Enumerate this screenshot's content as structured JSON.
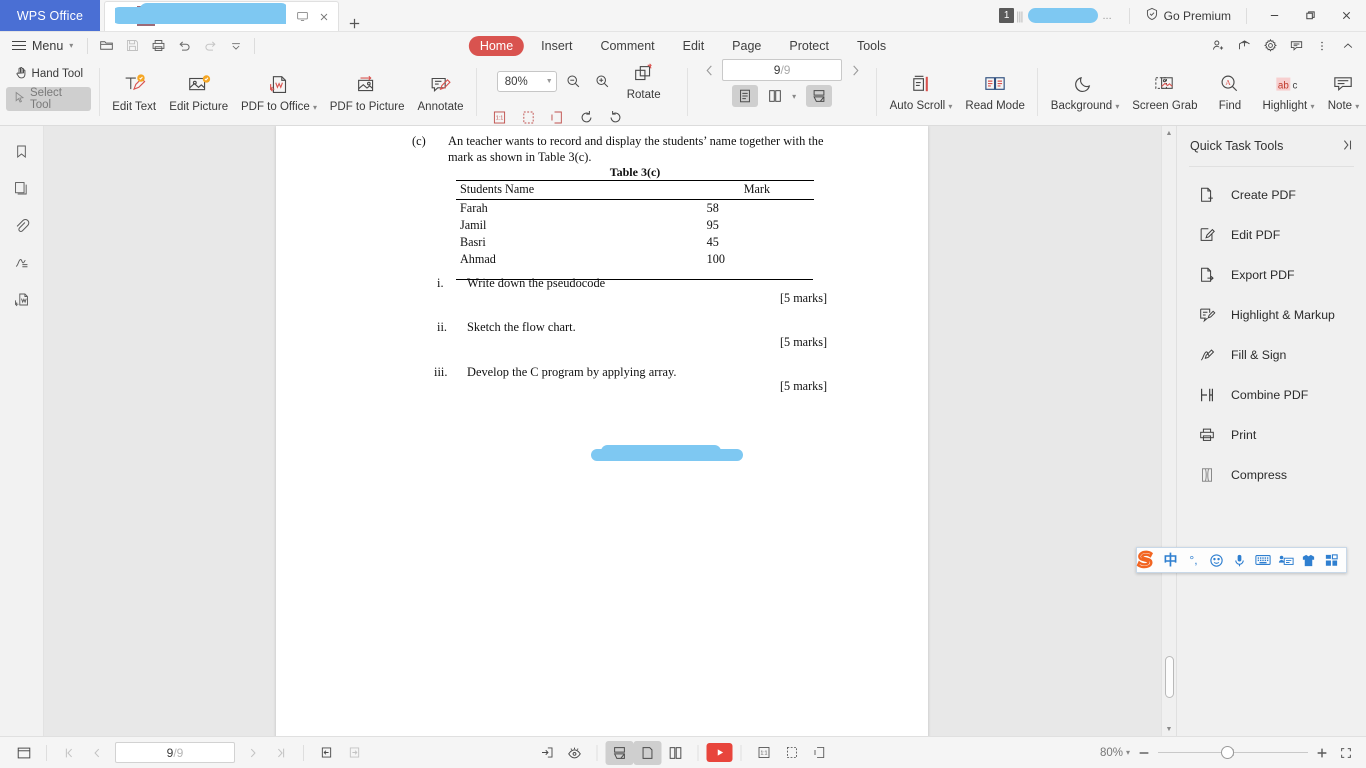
{
  "app": {
    "brand": "WPS Office",
    "tab_title": "",
    "premium_label": "Go Premium",
    "account_badge": "1"
  },
  "menubar": {
    "menu_label": "Menu",
    "quick_access": [
      {
        "name": "open-icon"
      },
      {
        "name": "save-icon"
      },
      {
        "name": "print-icon"
      },
      {
        "name": "undo-icon"
      },
      {
        "name": "redo-icon"
      },
      {
        "name": "customize-toolbar-icon"
      }
    ],
    "tabs": [
      {
        "label": "Home",
        "active": true
      },
      {
        "label": "Insert",
        "active": false
      },
      {
        "label": "Comment",
        "active": false
      },
      {
        "label": "Edit",
        "active": false
      },
      {
        "label": "Page",
        "active": false
      },
      {
        "label": "Protect",
        "active": false
      },
      {
        "label": "Tools",
        "active": false
      }
    ],
    "right_icons": [
      {
        "name": "share-user-icon"
      },
      {
        "name": "share-icon"
      },
      {
        "name": "settings-gear-icon"
      },
      {
        "name": "feedback-icon"
      },
      {
        "name": "more-options-icon"
      },
      {
        "name": "collapse-ribbon-icon"
      }
    ]
  },
  "ribbon": {
    "hand_tool": "Hand Tool",
    "select_tool": "Select Tool",
    "edit_text": "Edit Text",
    "edit_picture": "Edit Picture",
    "pdf_to_office": "PDF to Office",
    "pdf_to_picture": "PDF to Picture",
    "annotate": "Annotate",
    "zoom_value": "80%",
    "rotate": "Rotate",
    "auto_scroll": "Auto Scroll",
    "read_mode": "Read Mode",
    "background": "Background",
    "screen_grab": "Screen Grab",
    "find": "Find",
    "highlight": "Highlight",
    "note": "Note",
    "page_current": "9",
    "page_total": "/9"
  },
  "left_rail": [
    {
      "name": "bookmark-icon"
    },
    {
      "name": "thumbnails-icon"
    },
    {
      "name": "attachment-icon"
    },
    {
      "name": "signature-icon"
    },
    {
      "name": "pdf-convert-icon"
    }
  ],
  "right_panel": {
    "title": "Quick Task Tools",
    "items": [
      {
        "label": "Create PDF",
        "icon": "create-pdf-icon"
      },
      {
        "label": "Edit PDF",
        "icon": "edit-pdf-icon"
      },
      {
        "label": "Export PDF",
        "icon": "export-pdf-icon"
      },
      {
        "label": "Highlight & Markup",
        "icon": "highlight-markup-icon"
      },
      {
        "label": "Fill & Sign",
        "icon": "fill-sign-icon"
      },
      {
        "label": "Combine PDF",
        "icon": "combine-pdf-icon"
      },
      {
        "label": "Print",
        "icon": "print-icon"
      },
      {
        "label": "Compress",
        "icon": "compress-icon"
      }
    ]
  },
  "document": {
    "question_label": "(c)",
    "question_text": "An teacher wants to record and display the students’ name together with the mark as shown in Table 3(c).",
    "table_caption": "Table 3(c)",
    "table_headers": [
      "Students Name",
      "Mark"
    ],
    "table_rows": [
      [
        "Farah",
        "58"
      ],
      [
        "Jamil",
        "95"
      ],
      [
        "Basri",
        "45"
      ],
      [
        "Ahmad",
        "100"
      ]
    ],
    "subquestions": [
      {
        "num": "i.",
        "text": "Write down the pseudocode",
        "marks": "[5 marks]"
      },
      {
        "num": "ii.",
        "text": "Sketch the flow chart.",
        "marks": "[5 marks]"
      },
      {
        "num": "iii.",
        "text": "Develop the C program by applying array.",
        "marks": "[5 marks]"
      }
    ]
  },
  "ime": {
    "logo": "S",
    "items": [
      {
        "name": "language-chinese-icon",
        "glyph": "中"
      },
      {
        "name": "punctuation-icon",
        "glyph": "°,"
      },
      {
        "name": "emoji-icon",
        "glyph": "☺"
      },
      {
        "name": "voice-input-icon",
        "glyph": "•"
      },
      {
        "name": "soft-keyboard-icon",
        "glyph": "⌨"
      },
      {
        "name": "toolbox-icon",
        "glyph": "▤"
      },
      {
        "name": "skin-icon",
        "glyph": "▼"
      },
      {
        "name": "app-grid-icon",
        "glyph": "▦"
      }
    ]
  },
  "status_bar": {
    "page_current": "9",
    "page_total": "/9",
    "zoom_label": "80%",
    "left_icons": [
      {
        "name": "sidebar-toggle-icon"
      },
      {
        "name": "first-page-icon"
      },
      {
        "name": "previous-page-icon"
      },
      {
        "name": "next-page-icon"
      },
      {
        "name": "last-page-icon"
      },
      {
        "name": "previous-view-icon"
      },
      {
        "name": "next-view-icon"
      }
    ],
    "center_icons": [
      {
        "name": "insert-page-icon"
      },
      {
        "name": "eye-protection-icon"
      },
      {
        "name": "continuous-scroll-icon"
      },
      {
        "name": "single-page-icon"
      },
      {
        "name": "facing-pages-icon"
      },
      {
        "name": "presentation-play-icon"
      },
      {
        "name": "actual-size-icon"
      },
      {
        "name": "fit-page-icon"
      },
      {
        "name": "fit-width-icon"
      }
    ],
    "right_icons": [
      {
        "name": "zoom-out-icon"
      },
      {
        "name": "zoom-in-icon"
      },
      {
        "name": "fullscreen-icon"
      }
    ]
  }
}
